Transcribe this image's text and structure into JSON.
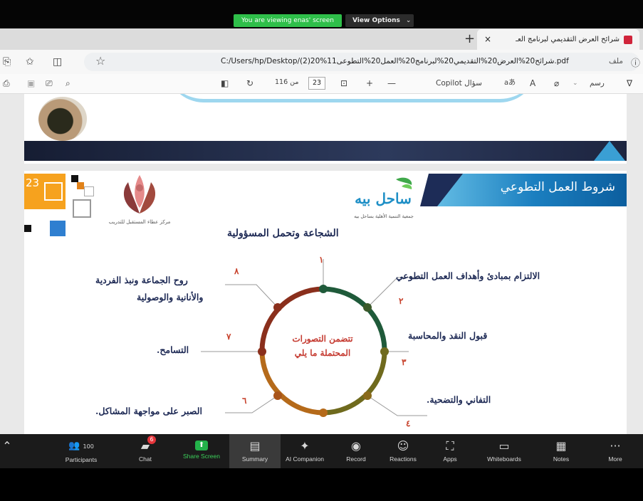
{
  "share_banner": {
    "viewing_text": "You are viewing enas' screen",
    "view_options": "View Options"
  },
  "browser": {
    "tab_title": "شرائح العرض التقديمي لبرنامج العـ",
    "tab_close": "×",
    "new_tab": "+",
    "url": "C:/Users/hp/Desktop/(2)20%1شرائح20%العرض20%التقديمي20%لبرنامج20%العمل20%التطوعى1.pdf",
    "file_label": "ملف"
  },
  "pdf_toolbar": {
    "draw_label": "رسم",
    "ask_copilot": "سؤال Copilot",
    "page_current": "23",
    "page_total": "من 116",
    "text_size": "A",
    "read_aloud": "aあ",
    "zoom_in": "+",
    "zoom_out": "—"
  },
  "slide": {
    "number": "23",
    "title": "شروط العمل التطوعي",
    "logo_right_text": "جمعية التنمية الأهلية بساحل بيه",
    "logo_right_mark": "ساحل بيه",
    "logo_left_text": "مركز عطاء المستقبل للتدريب",
    "top_heading": "الشجاعة وتحمل المسؤولية",
    "center_label_line1": "تتضمن التصورات",
    "center_label_line2": "المحتملة ما يلي",
    "conditions": [
      {
        "num": "١",
        "text": "الالتزام بمبادئ وأهداف العمل التطوعي",
        "num2": "٢"
      },
      {
        "text": "قبول النقد والمحاسبة",
        "num": "٣"
      },
      {
        "text": "التفاني والتضحية.",
        "num": "٤"
      },
      {
        "text": "الصبر على مواجهة المشاكل.",
        "num": "٦"
      },
      {
        "text": "التسامح.",
        "num": "٧"
      },
      {
        "text_line1": "روح الجماعة ونبذ الفردية",
        "text_line2": "والأنانية والوصولية",
        "num": "٨"
      }
    ],
    "colors": {
      "ring_top": "#1f5a3a",
      "ring_right": "#6f6a1d",
      "ring_bottom": "#b56a1a",
      "ring_left": "#8a2f1c",
      "title_blue": "#1b7fc0"
    }
  },
  "zoom_toolbar": {
    "participants_count": "100",
    "participants_label": "Participants",
    "chat_label": "Chat",
    "chat_badge": "6",
    "share_label": "Share Screen",
    "summary_label": "Summary",
    "ai_label": "AI Companion",
    "record_label": "Record",
    "reactions_label": "Reactions",
    "apps_label": "Apps",
    "whiteboards_label": "Whiteboards",
    "notes_label": "Notes",
    "more_label": "More"
  }
}
